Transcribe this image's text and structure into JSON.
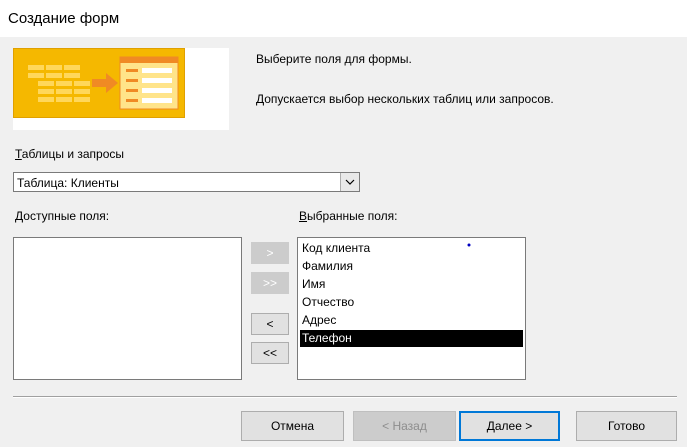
{
  "window": {
    "title": "Создание форм"
  },
  "intro": {
    "line1": "Выберите поля для формы.",
    "line2": "Допускается выбор нескольких таблиц или запросов."
  },
  "tables": {
    "label": "Таблицы и запросы",
    "label_accel": "Т",
    "label_rest": "аблицы и запросы",
    "selected": "Таблица: Клиенты"
  },
  "available": {
    "label_accel": "Д",
    "label_rest": "оступные поля:",
    "items": []
  },
  "selected_fields": {
    "label_accel": "В",
    "label_rest": "ыбранные поля:",
    "items": [
      "Код клиента",
      "Фамилия",
      "Имя",
      "Отчество",
      "Адрес",
      "Телефон"
    ],
    "highlighted_index": 5
  },
  "move_buttons": {
    "add_one": ">",
    "add_all": ">>",
    "remove_one": "<",
    "remove_all": "<<"
  },
  "buttons": {
    "cancel": "Отмена",
    "back": "< Назад",
    "next": "Далее >",
    "finish": "Готово"
  },
  "colors": {
    "accent": "#0078d7",
    "banner": "#f5b800",
    "selection": "#000000"
  }
}
